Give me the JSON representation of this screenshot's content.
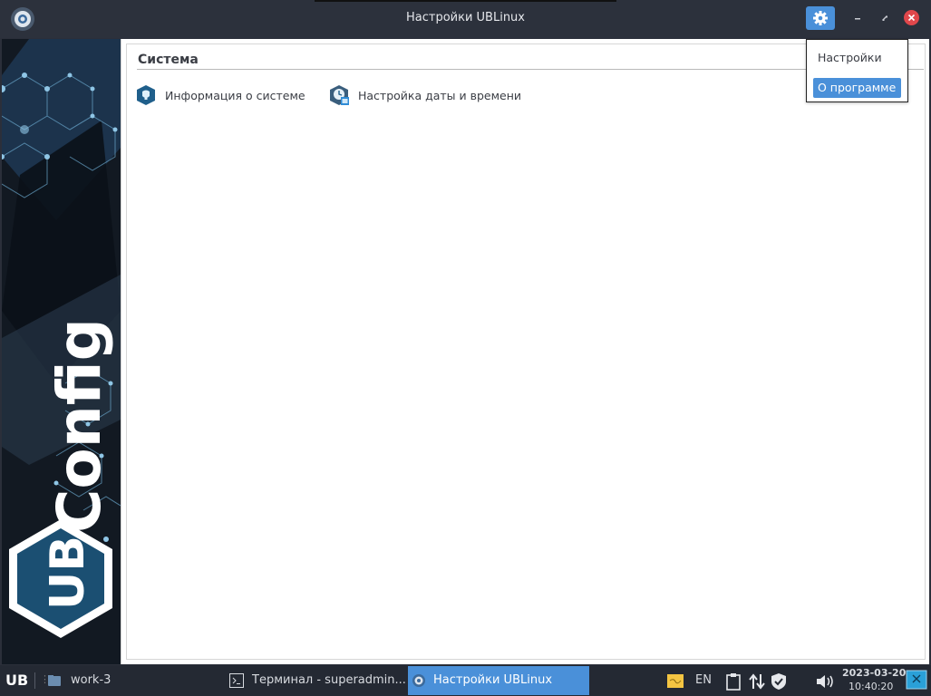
{
  "window": {
    "title": "Настройки UBLinux",
    "menu_icon": "gear-icon",
    "minimize_icon": "minimize-icon",
    "maximize_icon": "maximize-icon",
    "close_icon": "close-icon"
  },
  "sidebar": {
    "logo_text": "Config",
    "logo_badge": "UB"
  },
  "content": {
    "section_title": "Система",
    "items": [
      {
        "label": "Информация о системе",
        "icon": "info-shield-icon"
      },
      {
        "label": "Настройка даты и времени",
        "icon": "clock-calendar-icon"
      }
    ]
  },
  "popover": {
    "items": [
      {
        "label": "Настройки",
        "selected": false
      },
      {
        "label": "О программе",
        "selected": true
      }
    ]
  },
  "taskbar": {
    "start_label": "UB",
    "workspace": "work-3",
    "tasks": [
      {
        "label": "Терминал - superadmin...",
        "icon": "terminal-icon",
        "active": false
      },
      {
        "label": "Настройки UBLinux",
        "icon": "gear-icon",
        "active": true
      }
    ],
    "tray": {
      "keyboard_layout": "EN",
      "date": "2023-03-20",
      "time": "10:40:20"
    }
  },
  "colors": {
    "accent": "#4a90d9",
    "titlebar": "#2c313c",
    "taskbar": "#242933",
    "close": "#e0474b"
  }
}
